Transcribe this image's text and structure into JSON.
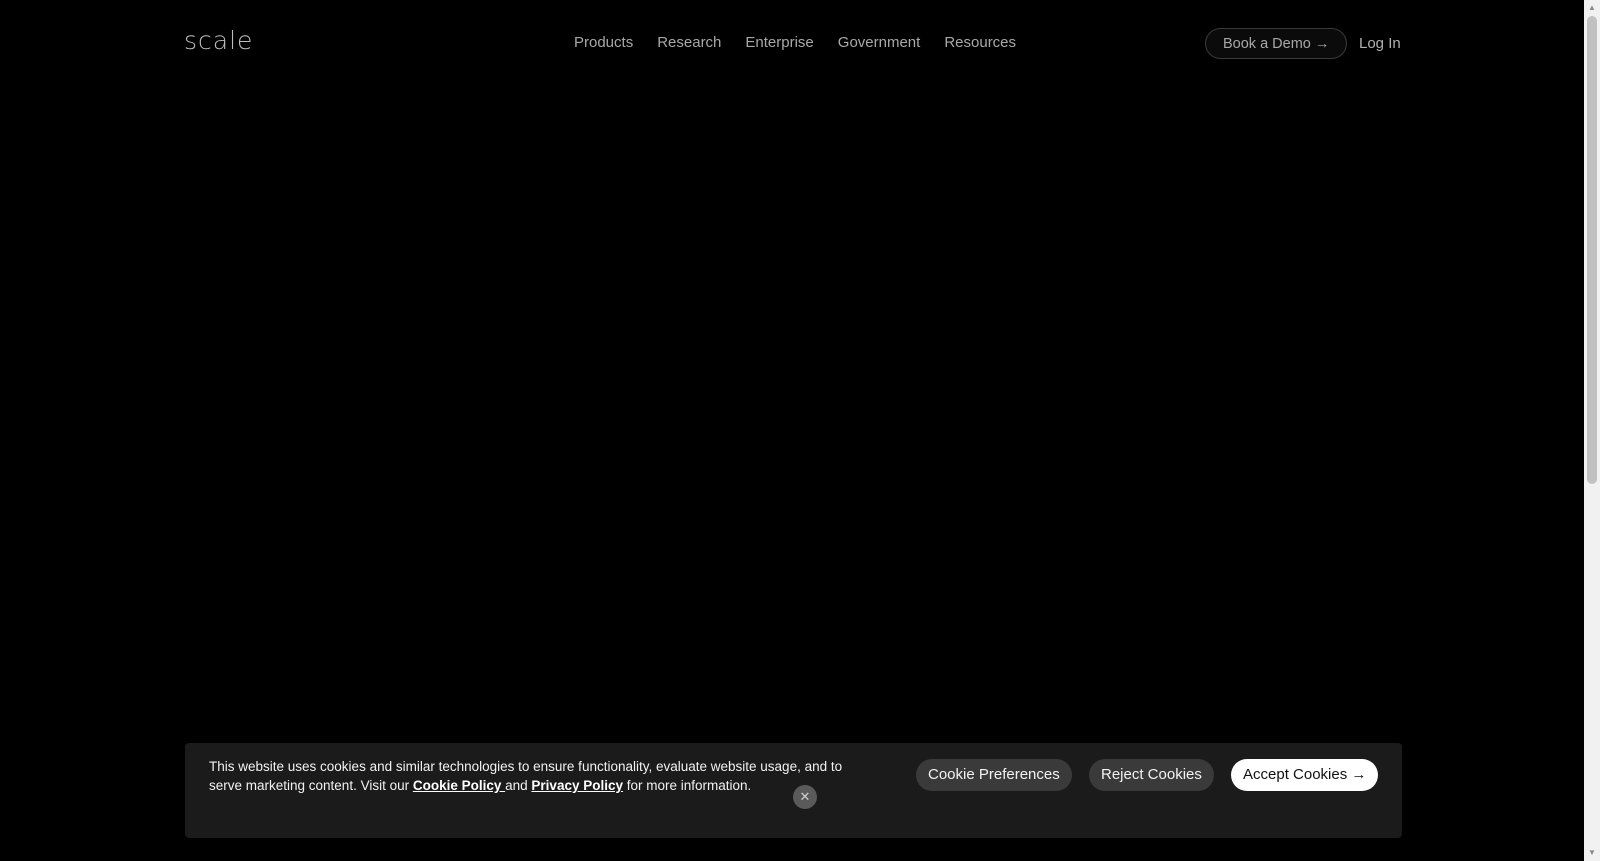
{
  "header": {
    "logo_text": "scale",
    "nav": [
      {
        "label": "Products"
      },
      {
        "label": "Research"
      },
      {
        "label": "Enterprise"
      },
      {
        "label": "Government"
      },
      {
        "label": "Resources"
      }
    ],
    "book_demo_label": "Book a Demo →",
    "login_label": "Log In"
  },
  "cookie_banner": {
    "text_before": "This website uses cookies and similar technologies to ensure functionality, evaluate website usage, and to serve marketing content. Visit our ",
    "cookie_policy_label": "Cookie Policy ",
    "text_and": "and ",
    "privacy_policy_label": "Privacy Policy",
    "text_after": " for more information.",
    "close_icon_glyph": "✕",
    "preferences_label": "Cookie Preferences",
    "reject_label": "Reject Cookies",
    "accept_label": "Accept Cookies →"
  },
  "scrollbar": {
    "up_glyph": "▲",
    "down_glyph": "▼"
  },
  "colors": {
    "background": "#000000",
    "banner_background": "#1b1b1b",
    "nav_text": "#a8a8a8",
    "accept_button_bg": "#ffffff",
    "secondary_button_bg": "#3a3a3a"
  }
}
